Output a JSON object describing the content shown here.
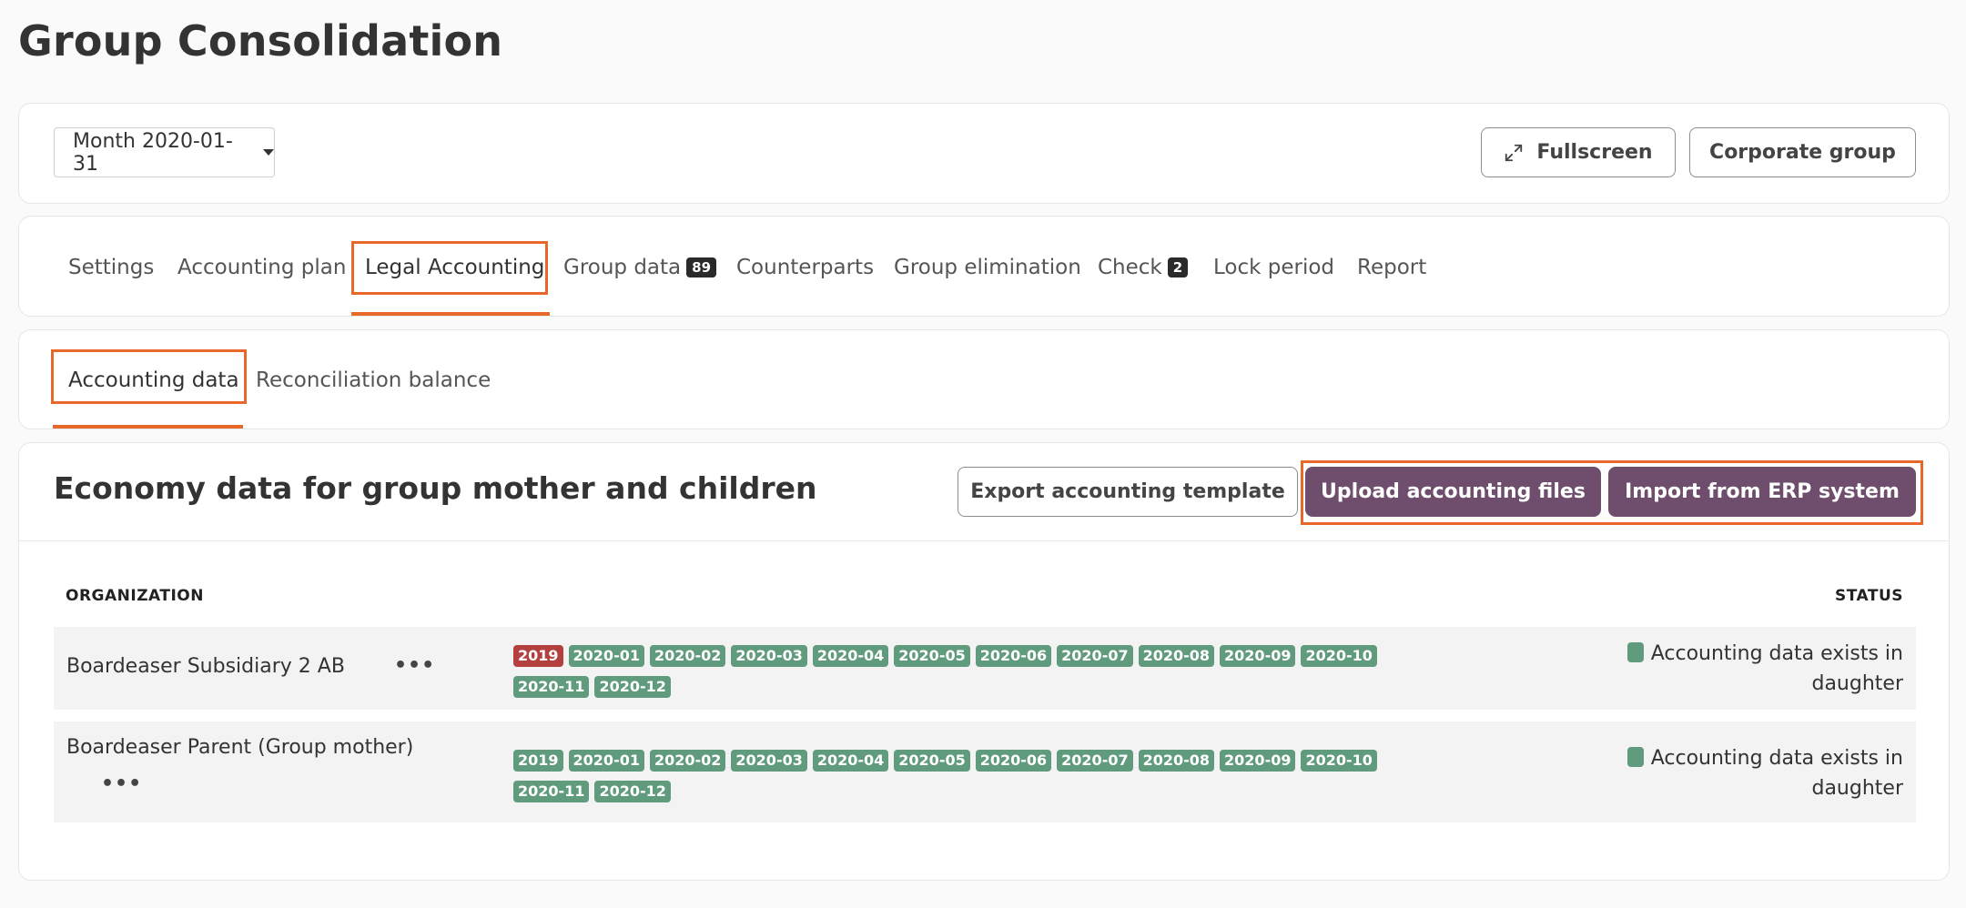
{
  "page": {
    "title": "Group Consolidation"
  },
  "toolbar": {
    "period": "Month 2020-01-31",
    "fullscreen": "Fullscreen",
    "corporate_group": "Corporate group"
  },
  "tabs": [
    {
      "label": "Settings",
      "active": false
    },
    {
      "label": "Accounting plan",
      "active": false
    },
    {
      "label": "Legal Accounting",
      "active": true
    },
    {
      "label": "Group data",
      "badge": "89",
      "active": false
    },
    {
      "label": "Counterparts",
      "active": false
    },
    {
      "label": "Group elimination",
      "active": false
    },
    {
      "label": "Check",
      "badge": "2",
      "active": false
    },
    {
      "label": "Lock period",
      "active": false
    },
    {
      "label": "Report",
      "active": false
    }
  ],
  "subtabs": [
    {
      "label": "Accounting data",
      "active": true
    },
    {
      "label": "Reconciliation balance",
      "active": false
    }
  ],
  "section": {
    "title": "Economy data for group mother and children",
    "export_button": "Export accounting template",
    "upload_button": "Upload accounting files",
    "import_button": "Import from ERP system"
  },
  "table": {
    "headers": {
      "organization": "ORGANIZATION",
      "status": "STATUS"
    },
    "rows": [
      {
        "organization": "Boardeaser Subsidiary 2 AB",
        "more": "•••",
        "periods": [
          {
            "label": "2019",
            "color": "#b3403f"
          },
          {
            "label": "2020-01",
            "color": "#5f9b7c"
          },
          {
            "label": "2020-02",
            "color": "#5f9b7c"
          },
          {
            "label": "2020-03",
            "color": "#5f9b7c"
          },
          {
            "label": "2020-04",
            "color": "#5f9b7c"
          },
          {
            "label": "2020-05",
            "color": "#5f9b7c"
          },
          {
            "label": "2020-06",
            "color": "#5f9b7c"
          },
          {
            "label": "2020-07",
            "color": "#5f9b7c"
          },
          {
            "label": "2020-08",
            "color": "#5f9b7c"
          },
          {
            "label": "2020-09",
            "color": "#5f9b7c"
          },
          {
            "label": "2020-10",
            "color": "#5f9b7c"
          },
          {
            "label": "2020-11",
            "color": "#5f9b7c"
          },
          {
            "label": "2020-12",
            "color": "#5f9b7c"
          }
        ],
        "status": "Accounting data exists in daughter"
      },
      {
        "organization": "Boardeaser Parent (Group mother)",
        "more": "•••",
        "periods": [
          {
            "label": "2019",
            "color": "#5f9b7c"
          },
          {
            "label": "2020-01",
            "color": "#5f9b7c"
          },
          {
            "label": "2020-02",
            "color": "#5f9b7c"
          },
          {
            "label": "2020-03",
            "color": "#5f9b7c"
          },
          {
            "label": "2020-04",
            "color": "#5f9b7c"
          },
          {
            "label": "2020-05",
            "color": "#5f9b7c"
          },
          {
            "label": "2020-06",
            "color": "#5f9b7c"
          },
          {
            "label": "2020-07",
            "color": "#5f9b7c"
          },
          {
            "label": "2020-08",
            "color": "#5f9b7c"
          },
          {
            "label": "2020-09",
            "color": "#5f9b7c"
          },
          {
            "label": "2020-10",
            "color": "#5f9b7c"
          },
          {
            "label": "2020-11",
            "color": "#5f9b7c"
          },
          {
            "label": "2020-12",
            "color": "#5f9b7c"
          }
        ],
        "status": "Accounting data exists in daughter"
      }
    ]
  },
  "colors": {
    "accent": "#e8682a",
    "primary": "#6f4e6d",
    "success": "#5f9b7c",
    "danger": "#b3403f"
  },
  "icons": {
    "fullscreen": "expand-arrows-icon",
    "dropdown": "caret-down-icon",
    "more": "ellipsis-icon"
  }
}
